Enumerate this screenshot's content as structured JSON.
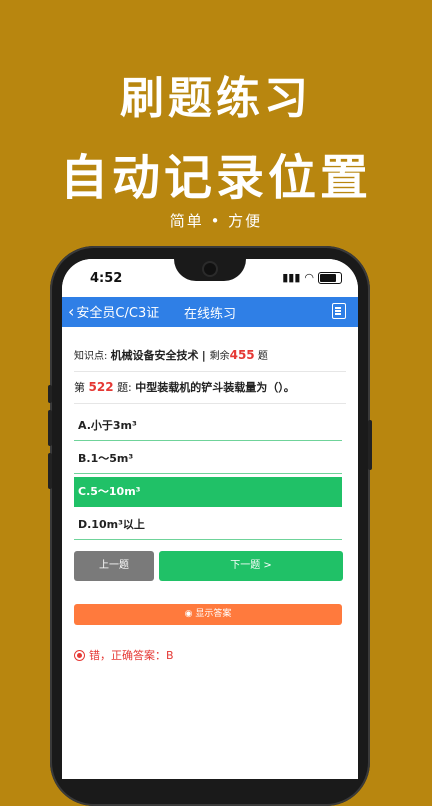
{
  "promo": {
    "line1": "刷题练习",
    "line2": "自动记录位置",
    "subtitle": "简单 • 方便"
  },
  "status_bar": {
    "time": "4:52"
  },
  "nav": {
    "back_label": "安全员C/C3证",
    "title": "在线练习",
    "right_icon": "list-icon"
  },
  "knowledge": {
    "prefix": "知识点:",
    "topic": "机械设备安全技术",
    "remaining_prefix": "剩余",
    "remaining_count": "455",
    "remaining_suffix": "题"
  },
  "question": {
    "prefix": "第",
    "number": "522",
    "suffix": "题:",
    "text": "中型装载机的铲斗装载量为（）。"
  },
  "options": [
    {
      "label": "A.小于3m³",
      "selected": false
    },
    {
      "label": "B.1～5m³",
      "selected": false
    },
    {
      "label": "C.5～10m³",
      "selected": true
    },
    {
      "label": "D.10m³以上",
      "selected": false
    }
  ],
  "buttons": {
    "prev": "上一题",
    "next": "下一题 >",
    "show_answer": "显示答案"
  },
  "result": {
    "text": "错，正确答案：B"
  },
  "colors": {
    "background": "#b8860f",
    "nav": "#2f7fe6",
    "correct": "#20c167",
    "answer_button": "#ff7a3d",
    "error": "#e53935"
  }
}
